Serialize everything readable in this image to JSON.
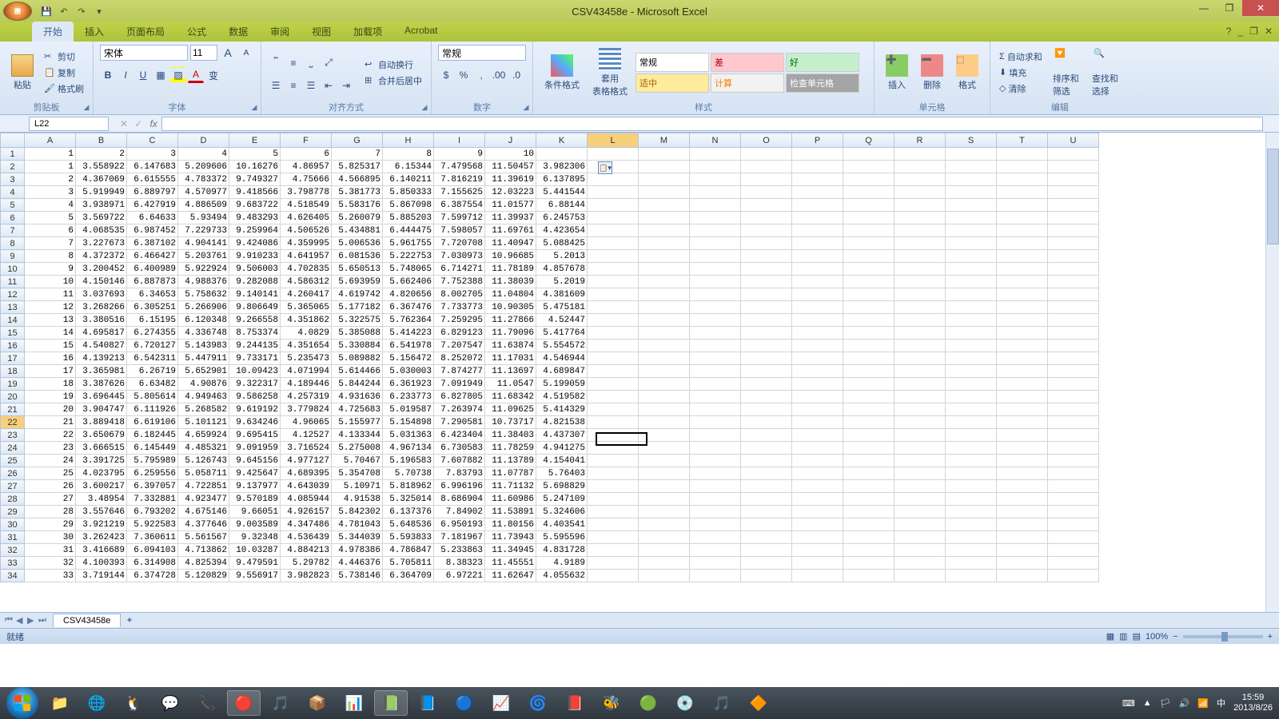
{
  "title": "CSV43458e - Microsoft Excel",
  "qat": {
    "save": "💾",
    "undo": "↶",
    "redo": "↷",
    "dd": "▾"
  },
  "win": {
    "min": "—",
    "max": "❐",
    "close": "✕"
  },
  "tabs": [
    "开始",
    "插入",
    "页面布局",
    "公式",
    "数据",
    "审阅",
    "视图",
    "加载项",
    "Acrobat"
  ],
  "active_tab": 0,
  "ribbon_help": {
    "q": "?",
    "min": "_",
    "rmax": "❐",
    "rclose": "✕"
  },
  "clipboard": {
    "title": "剪贴板",
    "paste": "粘贴",
    "cut": "剪切",
    "copy": "复制",
    "brush": "格式刷"
  },
  "font": {
    "title": "字体",
    "name": "宋体",
    "size": "11",
    "grow": "A",
    "shrink": "A",
    "bold": "B",
    "italic": "I",
    "underline": "U",
    "border": "▦",
    "fill": "▨",
    "color": "A",
    "phonetic": "变"
  },
  "align": {
    "title": "对齐方式",
    "wrap": "自动换行",
    "merge": "合并后居中"
  },
  "number": {
    "title": "数字",
    "format": "常规",
    "pct": "%",
    "comma": ",",
    "inc": ".00",
    "dec": ".0"
  },
  "styles": {
    "title": "样式",
    "cond": "条件格式",
    "table": "套用\n表格格式",
    "cells": [
      {
        "t": "常规",
        "bg": "#ffffff",
        "c": "#000"
      },
      {
        "t": "差",
        "bg": "#ffc7ce",
        "c": "#9c0006"
      },
      {
        "t": "好",
        "bg": "#c6efce",
        "c": "#006100"
      },
      {
        "t": "适中",
        "bg": "#ffeb9c",
        "c": "#9c6500"
      },
      {
        "t": "计算",
        "bg": "#f2f2f2",
        "c": "#fa7d00"
      },
      {
        "t": "检查单元格",
        "bg": "#a5a5a5",
        "c": "#ffffff"
      }
    ]
  },
  "cells": {
    "title": "单元格",
    "ins": "插入",
    "del": "删除",
    "fmt": "格式"
  },
  "edit": {
    "title": "编辑",
    "sum": "自动求和",
    "fill": "填充",
    "clear": "清除",
    "sort": "排序和\n筛选",
    "find": "查找和\n选择"
  },
  "namebox": "L22",
  "columns": [
    "A",
    "B",
    "C",
    "D",
    "E",
    "F",
    "G",
    "H",
    "I",
    "J",
    "K",
    "L",
    "M",
    "N",
    "O",
    "P",
    "Q",
    "R",
    "S",
    "T",
    "U"
  ],
  "active_col": "L",
  "active_row": 22,
  "smart_tag_pos": {
    "row": 2,
    "col": "L"
  },
  "rows": [
    [
      "1",
      "1",
      "2",
      "3",
      "4",
      "5",
      "6",
      "7",
      "8",
      "9",
      "10",
      "",
      "",
      "",
      "",
      "",
      "",
      "",
      "",
      "",
      "",
      ""
    ],
    [
      "2",
      "1",
      "3.558922",
      "6.147683",
      "5.209606",
      "10.16276",
      "4.86957",
      "5.825317",
      "6.15344",
      "7.479568",
      "11.50457",
      "3.982306",
      "",
      "",
      "",
      "",
      "",
      "",
      "",
      "",
      "",
      ""
    ],
    [
      "3",
      "2",
      "4.367069",
      "6.615555",
      "4.783372",
      "9.749327",
      "4.75666",
      "4.566895",
      "6.140211",
      "7.816219",
      "11.39619",
      "6.137895",
      "",
      "",
      "",
      "",
      "",
      "",
      "",
      "",
      "",
      ""
    ],
    [
      "4",
      "3",
      "5.919949",
      "6.889797",
      "4.570977",
      "9.418566",
      "3.798778",
      "5.381773",
      "5.850333",
      "7.155625",
      "12.03223",
      "5.441544",
      "",
      "",
      "",
      "",
      "",
      "",
      "",
      "",
      "",
      ""
    ],
    [
      "5",
      "4",
      "3.938971",
      "6.427919",
      "4.886509",
      "9.683722",
      "4.518549",
      "5.583176",
      "5.867098",
      "6.387554",
      "11.01577",
      "6.88144",
      "",
      "",
      "",
      "",
      "",
      "",
      "",
      "",
      "",
      ""
    ],
    [
      "6",
      "5",
      "3.569722",
      "6.64633",
      "5.93494",
      "9.483293",
      "4.626405",
      "5.260079",
      "5.885203",
      "7.599712",
      "11.39937",
      "6.245753",
      "",
      "",
      "",
      "",
      "",
      "",
      "",
      "",
      "",
      ""
    ],
    [
      "7",
      "6",
      "4.068535",
      "6.987452",
      "7.229733",
      "9.259964",
      "4.506526",
      "5.434881",
      "6.444475",
      "7.598057",
      "11.69761",
      "4.423654",
      "",
      "",
      "",
      "",
      "",
      "",
      "",
      "",
      "",
      ""
    ],
    [
      "8",
      "7",
      "3.227673",
      "6.387102",
      "4.904141",
      "9.424086",
      "4.359995",
      "5.006536",
      "5.961755",
      "7.720708",
      "11.40947",
      "5.088425",
      "",
      "",
      "",
      "",
      "",
      "",
      "",
      "",
      "",
      ""
    ],
    [
      "9",
      "8",
      "4.372372",
      "6.466427",
      "5.203761",
      "9.910233",
      "4.641957",
      "6.081536",
      "5.222753",
      "7.030973",
      "10.96685",
      "5.2013",
      "",
      "",
      "",
      "",
      "",
      "",
      "",
      "",
      "",
      ""
    ],
    [
      "10",
      "9",
      "3.200452",
      "6.400989",
      "5.922924",
      "9.506003",
      "4.702835",
      "5.650513",
      "5.748065",
      "6.714271",
      "11.78189",
      "4.857678",
      "",
      "",
      "",
      "",
      "",
      "",
      "",
      "",
      "",
      ""
    ],
    [
      "11",
      "10",
      "4.150146",
      "6.887873",
      "4.988376",
      "9.282088",
      "4.586312",
      "5.693959",
      "5.662406",
      "7.752388",
      "11.38039",
      "5.2019",
      "",
      "",
      "",
      "",
      "",
      "",
      "",
      "",
      "",
      ""
    ],
    [
      "12",
      "11",
      "3.037693",
      "6.34653",
      "5.758632",
      "9.140141",
      "4.260417",
      "4.619742",
      "4.820656",
      "8.002705",
      "11.04804",
      "4.381609",
      "",
      "",
      "",
      "",
      "",
      "",
      "",
      "",
      "",
      ""
    ],
    [
      "13",
      "12",
      "3.268266",
      "6.305251",
      "5.266906",
      "9.806649",
      "5.365065",
      "5.177182",
      "6.367476",
      "7.733773",
      "10.90305",
      "5.475181",
      "",
      "",
      "",
      "",
      "",
      "",
      "",
      "",
      "",
      ""
    ],
    [
      "14",
      "13",
      "3.380516",
      "6.15195",
      "6.120348",
      "9.266558",
      "4.351862",
      "5.322575",
      "5.762364",
      "7.259295",
      "11.27866",
      "4.52447",
      "",
      "",
      "",
      "",
      "",
      "",
      "",
      "",
      "",
      ""
    ],
    [
      "15",
      "14",
      "4.695817",
      "6.274355",
      "4.336748",
      "8.753374",
      "4.0829",
      "5.385088",
      "5.414223",
      "6.829123",
      "11.79096",
      "5.417764",
      "",
      "",
      "",
      "",
      "",
      "",
      "",
      "",
      "",
      ""
    ],
    [
      "16",
      "15",
      "4.540827",
      "6.720127",
      "5.143983",
      "9.244135",
      "4.351654",
      "5.330884",
      "6.541978",
      "7.207547",
      "11.63874",
      "5.554572",
      "",
      "",
      "",
      "",
      "",
      "",
      "",
      "",
      "",
      ""
    ],
    [
      "17",
      "16",
      "4.139213",
      "6.542311",
      "5.447911",
      "9.733171",
      "5.235473",
      "5.089882",
      "5.156472",
      "8.252072",
      "11.17031",
      "4.546944",
      "",
      "",
      "",
      "",
      "",
      "",
      "",
      "",
      "",
      ""
    ],
    [
      "18",
      "17",
      "3.365981",
      "6.26719",
      "5.652901",
      "10.09423",
      "4.071994",
      "5.614466",
      "5.030003",
      "7.874277",
      "11.13697",
      "4.689847",
      "",
      "",
      "",
      "",
      "",
      "",
      "",
      "",
      "",
      ""
    ],
    [
      "19",
      "18",
      "3.387626",
      "6.63482",
      "4.90876",
      "9.322317",
      "4.189446",
      "5.844244",
      "6.361923",
      "7.091949",
      "11.0547",
      "5.199059",
      "",
      "",
      "",
      "",
      "",
      "",
      "",
      "",
      "",
      ""
    ],
    [
      "20",
      "19",
      "3.696445",
      "5.805614",
      "4.949463",
      "9.586258",
      "4.257319",
      "4.931636",
      "6.233773",
      "6.827805",
      "11.68342",
      "4.519582",
      "",
      "",
      "",
      "",
      "",
      "",
      "",
      "",
      "",
      ""
    ],
    [
      "21",
      "20",
      "3.904747",
      "6.111926",
      "5.268582",
      "9.619192",
      "3.779824",
      "4.725683",
      "5.019587",
      "7.263974",
      "11.09625",
      "5.414329",
      "",
      "",
      "",
      "",
      "",
      "",
      "",
      "",
      "",
      ""
    ],
    [
      "22",
      "21",
      "3.889418",
      "6.619106",
      "5.101121",
      "9.634246",
      "4.96065",
      "5.155977",
      "5.154898",
      "7.290581",
      "10.73717",
      "4.821538",
      "",
      "",
      "",
      "",
      "",
      "",
      "",
      "",
      "",
      ""
    ],
    [
      "23",
      "22",
      "3.650679",
      "6.182445",
      "4.659924",
      "9.695415",
      "4.12527",
      "4.133344",
      "5.031363",
      "6.423404",
      "11.38403",
      "4.437307",
      "",
      "",
      "",
      "",
      "",
      "",
      "",
      "",
      "",
      ""
    ],
    [
      "24",
      "23",
      "3.666515",
      "6.145449",
      "4.485321",
      "9.091959",
      "3.716524",
      "5.275008",
      "4.967134",
      "6.730583",
      "11.78259",
      "4.941275",
      "",
      "",
      "",
      "",
      "",
      "",
      "",
      "",
      "",
      ""
    ],
    [
      "25",
      "24",
      "3.391725",
      "5.795989",
      "5.126743",
      "9.645156",
      "4.977127",
      "5.70467",
      "5.196583",
      "7.607882",
      "11.13789",
      "4.154041",
      "",
      "",
      "",
      "",
      "",
      "",
      "",
      "",
      "",
      ""
    ],
    [
      "26",
      "25",
      "4.023795",
      "6.259556",
      "5.058711",
      "9.425647",
      "4.689395",
      "5.354708",
      "5.70738",
      "7.83793",
      "11.07787",
      "5.76403",
      "",
      "",
      "",
      "",
      "",
      "",
      "",
      "",
      "",
      ""
    ],
    [
      "27",
      "26",
      "3.600217",
      "6.397057",
      "4.722851",
      "9.137977",
      "4.643039",
      "5.10971",
      "5.818962",
      "6.996196",
      "11.71132",
      "5.698829",
      "",
      "",
      "",
      "",
      "",
      "",
      "",
      "",
      "",
      ""
    ],
    [
      "28",
      "27",
      "3.48954",
      "7.332881",
      "4.923477",
      "9.570189",
      "4.085944",
      "4.91538",
      "5.325014",
      "8.686904",
      "11.60986",
      "5.247109",
      "",
      "",
      "",
      "",
      "",
      "",
      "",
      "",
      "",
      ""
    ],
    [
      "29",
      "28",
      "3.557646",
      "6.793202",
      "4.675146",
      "9.66051",
      "4.926157",
      "5.842302",
      "6.137376",
      "7.84902",
      "11.53891",
      "5.324606",
      "",
      "",
      "",
      "",
      "",
      "",
      "",
      "",
      "",
      ""
    ],
    [
      "30",
      "29",
      "3.921219",
      "5.922583",
      "4.377646",
      "9.003589",
      "4.347486",
      "4.781043",
      "5.648536",
      "6.950193",
      "11.80156",
      "4.403541",
      "",
      "",
      "",
      "",
      "",
      "",
      "",
      "",
      "",
      ""
    ],
    [
      "31",
      "30",
      "3.262423",
      "7.360611",
      "5.561567",
      "9.32348",
      "4.536439",
      "5.344039",
      "5.593833",
      "7.181967",
      "11.73943",
      "5.595596",
      "",
      "",
      "",
      "",
      "",
      "",
      "",
      "",
      "",
      ""
    ],
    [
      "32",
      "31",
      "3.416689",
      "6.094103",
      "4.713862",
      "10.03287",
      "4.884213",
      "4.978386",
      "4.786847",
      "5.233863",
      "11.34945",
      "4.831728",
      "",
      "",
      "",
      "",
      "",
      "",
      "",
      "",
      "",
      ""
    ],
    [
      "33",
      "32",
      "4.100393",
      "6.314908",
      "4.825394",
      "9.479591",
      "5.29782",
      "4.446376",
      "5.705811",
      "8.38323",
      "11.45551",
      "4.9189",
      "",
      "",
      "",
      "",
      "",
      "",
      "",
      "",
      "",
      ""
    ],
    [
      "34",
      "33",
      "3.719144",
      "6.374728",
      "5.120829",
      "9.556917",
      "3.982823",
      "5.738146",
      "6.364709",
      "6.97221",
      "11.62647",
      "4.055632",
      "",
      "",
      "",
      "",
      "",
      "",
      "",
      "",
      "",
      ""
    ]
  ],
  "sheet_tab": "CSV43458e",
  "status": "就绪",
  "zoom": "100%",
  "views": {
    "normal": "▦",
    "layout": "▥",
    "break": "▤"
  },
  "taskbar_icons": [
    "📁",
    "🌐",
    "🐧",
    "💬",
    "📞",
    "🔴",
    "🎵",
    "📦",
    "📊",
    "📗",
    "📘",
    "🔵",
    "📈",
    "🌀",
    "📕",
    "🐝",
    "🟢",
    "💿",
    "🎵",
    "🔶"
  ],
  "tray": {
    "time": "15:59",
    "date": "2013/8/26",
    "lang": "中"
  }
}
